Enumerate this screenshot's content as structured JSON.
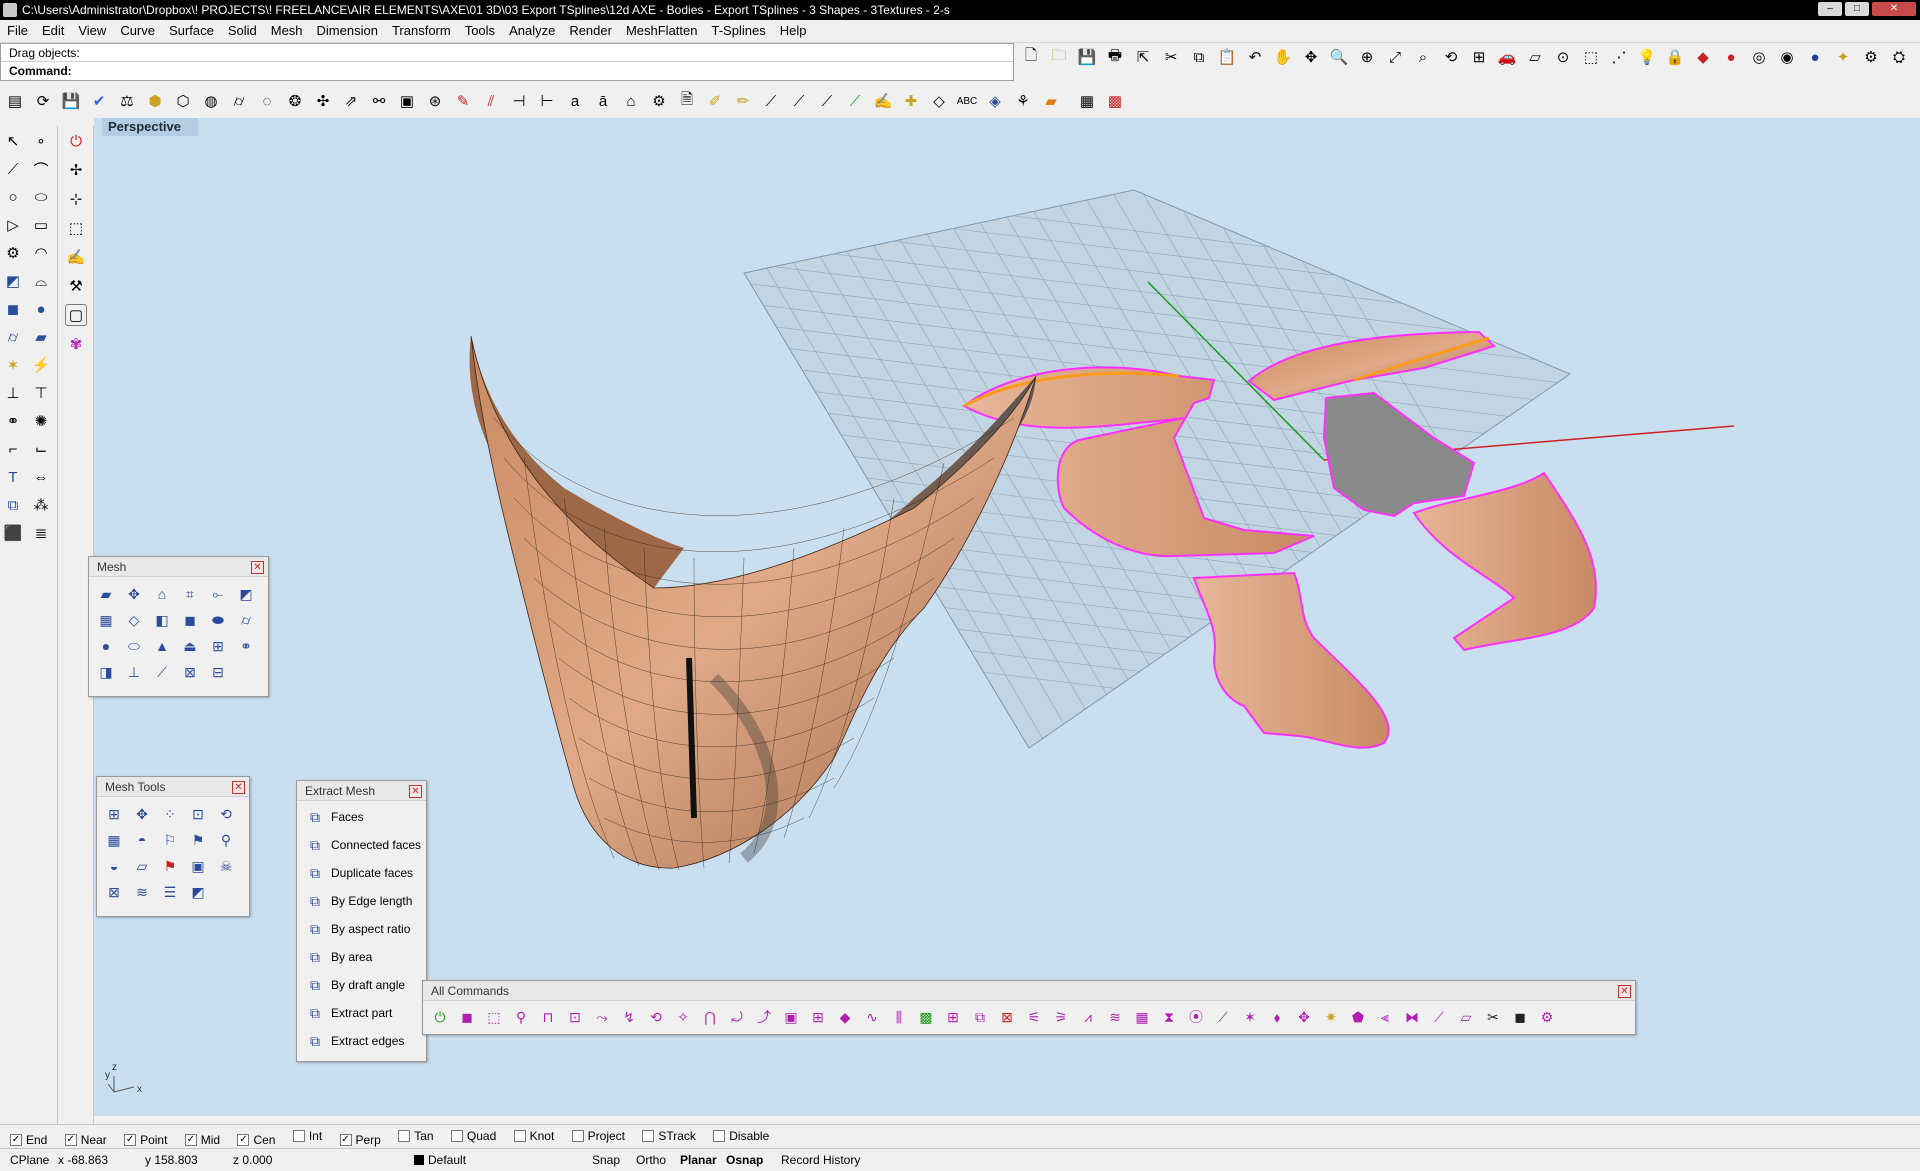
{
  "titlebar": {
    "title": "C:\\Users\\Administrator\\Dropbox\\! PROJECTS\\! FREELANCE\\AIR ELEMENTS\\AXE\\01 3D\\03 Export TSplines\\12d AXE - Bodies - Export TSplines - 3 Shapes - 3Textures - 2-s"
  },
  "menubar": {
    "items": [
      "File",
      "Edit",
      "View",
      "Curve",
      "Surface",
      "Solid",
      "Mesh",
      "Dimension",
      "Transform",
      "Tools",
      "Analyze",
      "Render",
      "MeshFlatten",
      "T-Splines",
      "Help"
    ]
  },
  "command": {
    "prompt_line": "Drag objects:",
    "command_label": "Command:"
  },
  "viewport": {
    "title": "Perspective",
    "axis_x": "x",
    "axis_y": "y",
    "axis_z": "z"
  },
  "mesh_panel": {
    "title": "Mesh"
  },
  "mesh_tools_panel": {
    "title": "Mesh Tools"
  },
  "extract_mesh_panel": {
    "title": "Extract Mesh",
    "items": [
      "Faces",
      "Connected faces",
      "Duplicate faces",
      "By Edge length",
      "By aspect ratio",
      "By area",
      "By draft angle",
      "Extract part",
      "Extract edges"
    ]
  },
  "all_commands_panel": {
    "title": "All Commands"
  },
  "osnap": {
    "items": [
      {
        "label": "End",
        "checked": true
      },
      {
        "label": "Near",
        "checked": true
      },
      {
        "label": "Point",
        "checked": true
      },
      {
        "label": "Mid",
        "checked": true
      },
      {
        "label": "Cen",
        "checked": true
      },
      {
        "label": "Int",
        "checked": false
      },
      {
        "label": "Perp",
        "checked": true
      },
      {
        "label": "Tan",
        "checked": false
      },
      {
        "label": "Quad",
        "checked": false
      },
      {
        "label": "Knot",
        "checked": false
      },
      {
        "label": "Project",
        "checked": false
      },
      {
        "label": "STrack",
        "checked": false
      },
      {
        "label": "Disable",
        "checked": false
      }
    ]
  },
  "status": {
    "cplane": "CPlane",
    "x": "x -68.863",
    "y": "y 158.803",
    "z": "z 0.000",
    "layer": "Default",
    "snap": "Snap",
    "ortho": "Ortho",
    "planar": "Planar",
    "osnap": "Osnap",
    "record_history": "Record History"
  },
  "colors": {
    "viewport_bg": "#c9dff0",
    "grid": "#8fa6b8",
    "axis_x": "#d22020",
    "axis_y": "#1a9a1a",
    "skin": "#d9a27c",
    "selection": "#ff30ff",
    "highlight": "#ff9a1a"
  }
}
